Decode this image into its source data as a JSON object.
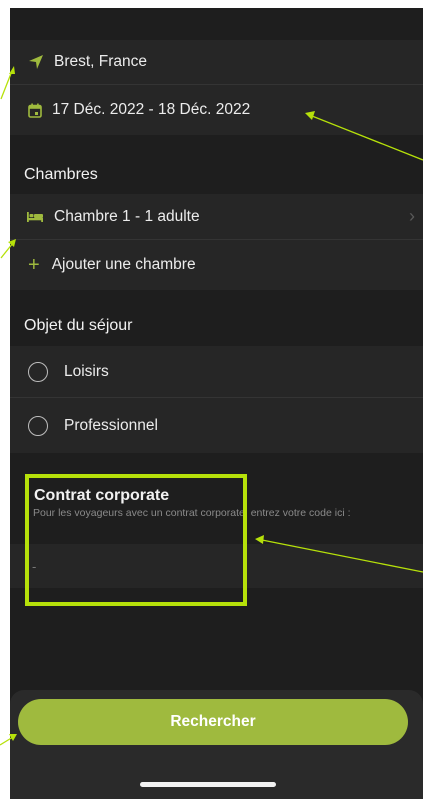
{
  "search": {
    "destination": "Brest, France",
    "dates": "17 Déc. 2022 - 18 Déc. 2022"
  },
  "rooms": {
    "header": "Chambres",
    "room_label": "Chambre 1 - 1 adulte",
    "add_label": "Ajouter une chambre"
  },
  "purpose": {
    "header": "Objet du séjour",
    "options": [
      "Loisirs",
      "Professionnel"
    ]
  },
  "corporate": {
    "title": "Contrat corporate",
    "description": "Pour les voyageurs avec un contrat corporate, entrez votre code ici :",
    "input_value": "-"
  },
  "action": {
    "search_label": "Rechercher"
  },
  "colors": {
    "accent": "#9fba3e",
    "highlight": "#b6e10a",
    "background": "#1e1e1e"
  }
}
